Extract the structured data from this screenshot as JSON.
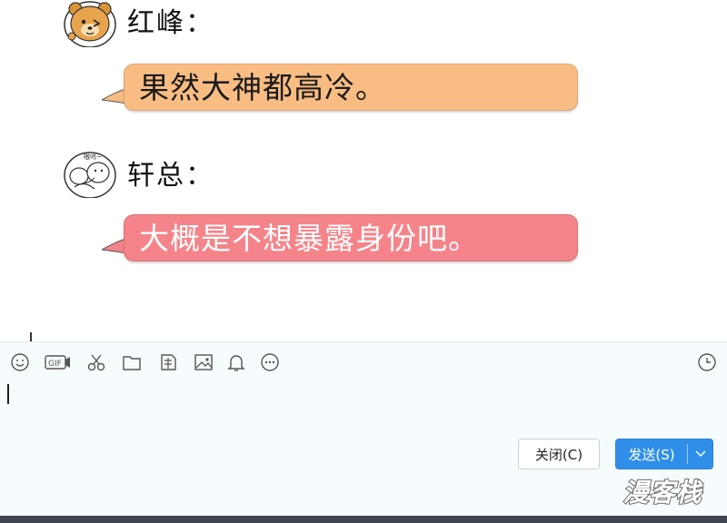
{
  "messages": [
    {
      "sender": "红峰：",
      "text": "果然大神都高冷。",
      "bubble_color": "#f9bd83",
      "avatar": "bear-avatar"
    },
    {
      "sender": "轩总：",
      "text": "大概是不想暴露身份吧。",
      "bubble_color": "#f48489",
      "avatar": "doodle-avatar",
      "avatar_caption": "嗷呜~"
    }
  ],
  "toolbar": {
    "icons": [
      "emoji-icon",
      "gif-icon",
      "scissors-icon",
      "folder-icon",
      "document-icon",
      "image-icon",
      "bell-icon",
      "more-icon"
    ],
    "history_icon": "clock-icon"
  },
  "composer": {
    "close_label": "关闭(C)",
    "send_label": "发送(S)"
  },
  "watermark": {
    "text": "漫客栈"
  },
  "colors": {
    "composer_bg": "#f6fbfe",
    "send_button": "#2f8fe8",
    "bubble_orange": "#f9bd83",
    "bubble_red": "#f48489"
  }
}
